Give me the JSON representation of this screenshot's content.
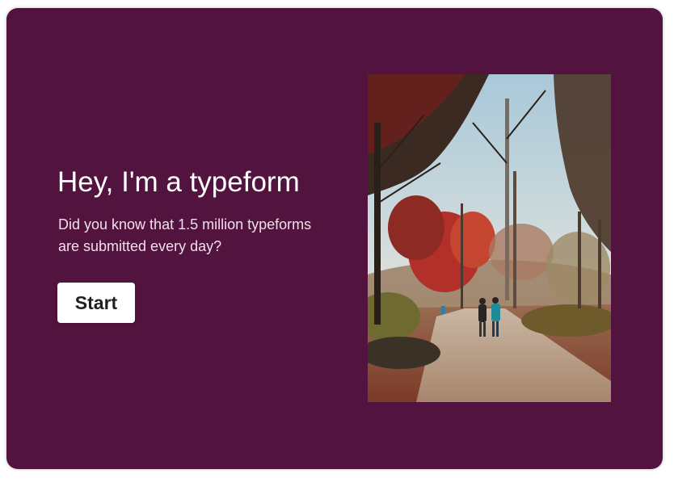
{
  "colors": {
    "card_background": "#53133f",
    "title_text": "#ffffff",
    "button_background": "#ffffff",
    "button_text": "#1f1f1f"
  },
  "welcome": {
    "title": "Hey, I'm a typeform",
    "subtitle": "Did you know that 1.5 million typeforms are submitted every day?",
    "start_label": "Start"
  },
  "image": {
    "subject": "autumn park path with red-leaved trees and two people walking"
  }
}
